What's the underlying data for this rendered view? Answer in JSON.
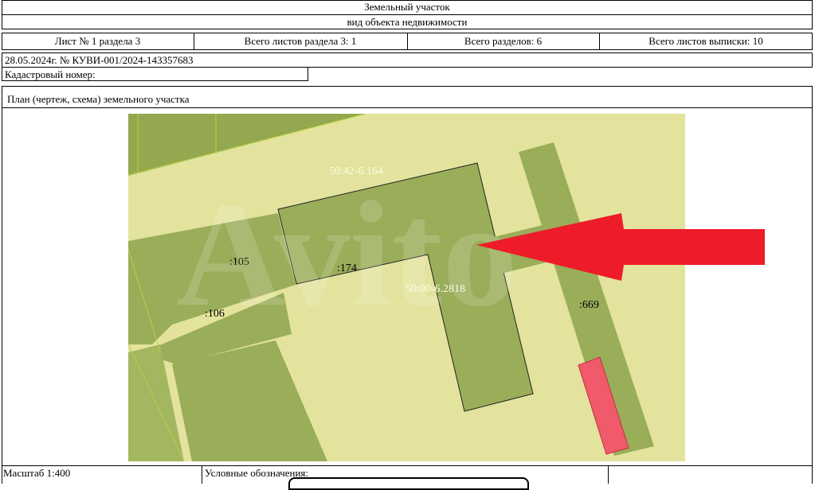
{
  "header": {
    "title": "Земельный участок",
    "subtitle": "вид объекта недвижимости"
  },
  "sheet_info": {
    "sheet": "Лист № 1 раздела 3",
    "total_sheets_section": "Всего листов раздела 3: 1",
    "total_sections": "Всего разделов: 6",
    "total_sheets_extract": "Всего листов выписки: 10"
  },
  "extract": {
    "date_number": "28.05.2024г. № КУВИ-001/2024-143357683",
    "cadastral_label": "Кадастровый номер:",
    "cadastral_value": ""
  },
  "plan": {
    "heading": "План (чертеж, схема) земельного участка",
    "labels": {
      "quarter_top": "50:42-6.164",
      "quarter_mid": "50:00-6.2818",
      "p105": ":105",
      "p106": ":106",
      "p174": ":174",
      "p669": ":669"
    },
    "watermark": "Avito",
    "colors": {
      "background": "#e3e39d",
      "parcel": "#9aad59",
      "parcel_dark": "#8aa04c",
      "boundary": "#222222",
      "arrow": "#ee1c2a",
      "building": "#f05a6a"
    }
  },
  "footer": {
    "scale": "Масштаб 1:400",
    "legend": "Условные обозначения:"
  }
}
